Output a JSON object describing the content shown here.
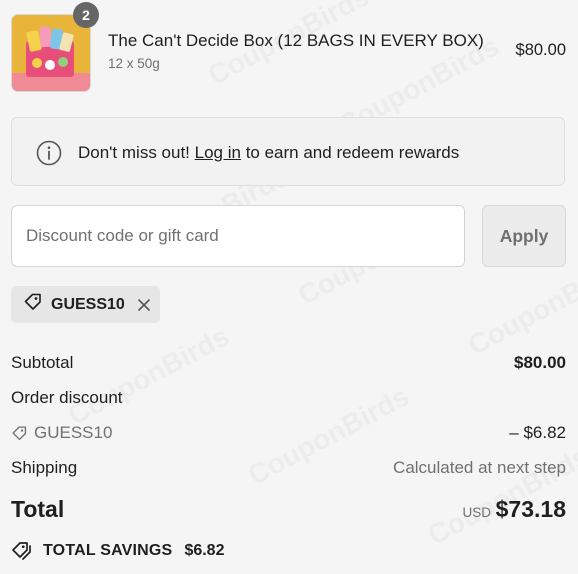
{
  "product": {
    "quantity_badge": "2",
    "name": "The Can't Decide Box (12 BAGS IN EVERY BOX)",
    "variant": "12 x 50g",
    "price": "$80.00",
    "image_icon": "product-box-image"
  },
  "banner": {
    "icon": "info-icon",
    "text_before": "Don't miss out!",
    "link_text": "Log in",
    "text_after": "to earn and redeem rewards"
  },
  "discount": {
    "placeholder": "Discount code or gift card",
    "value": "",
    "apply_label": "Apply",
    "applied_code": "GUESS10",
    "tag_icon": "tag-icon",
    "remove_icon": "close-icon"
  },
  "summary": {
    "subtotal_label": "Subtotal",
    "subtotal_value": "$80.00",
    "order_discount_label": "Order discount",
    "discount_code": "GUESS10",
    "discount_value": "– $6.82",
    "shipping_label": "Shipping",
    "shipping_value": "Calculated at next step",
    "total_label": "Total",
    "currency": "USD",
    "total_value": "$73.18",
    "savings_label": "TOTAL SAVINGS",
    "savings_value": "$6.82"
  },
  "watermark": "CouponBirds",
  "colors": {
    "background": "#f5f5f5",
    "text": "#1f1f1f",
    "muted": "#707070",
    "badge": "#666666"
  }
}
